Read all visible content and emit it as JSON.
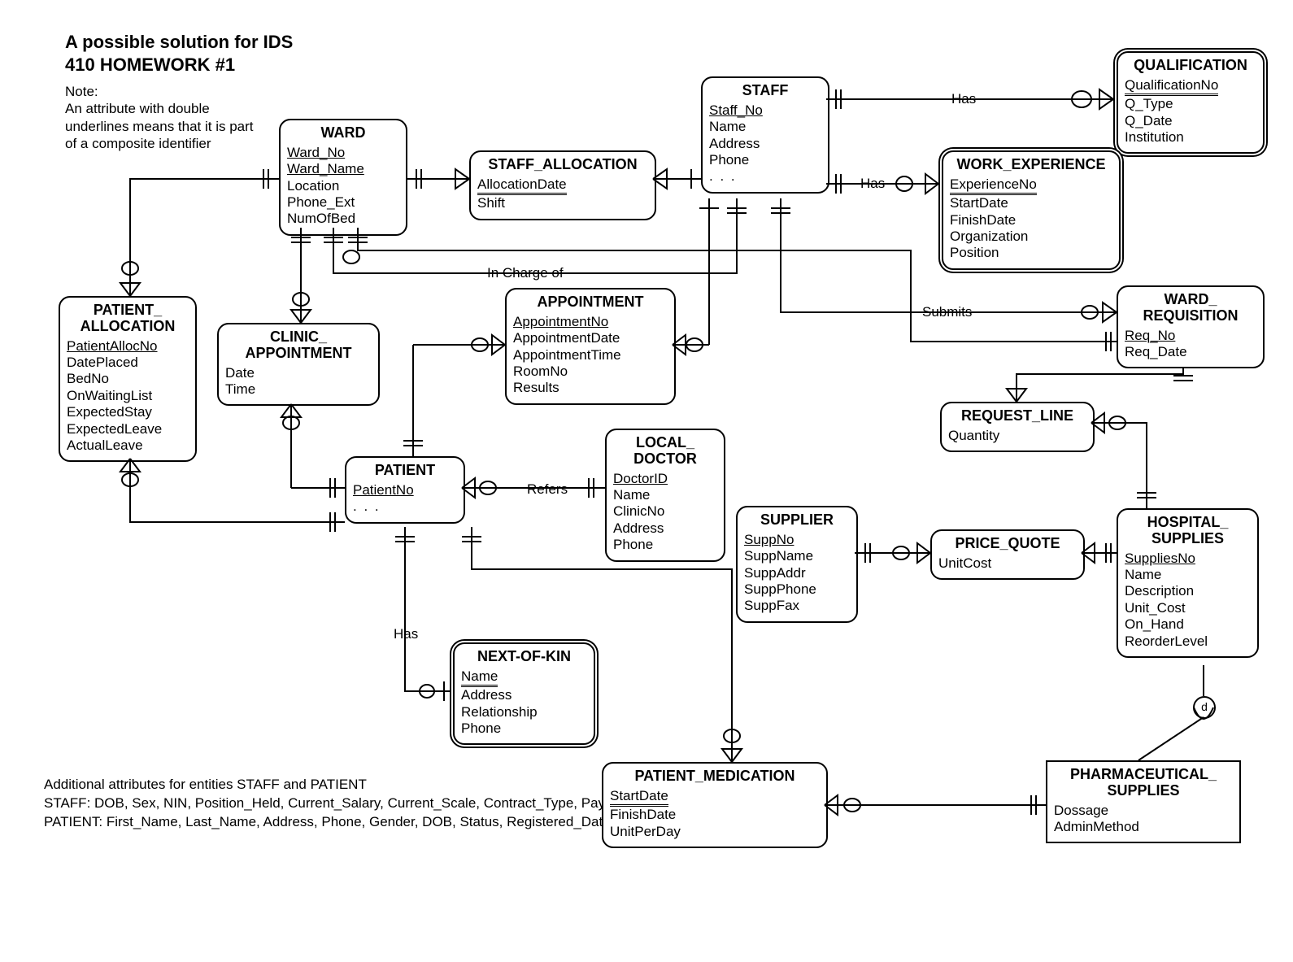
{
  "header": {
    "l1": "A possible solution for IDS",
    "l2": "410 HOMEWORK #1"
  },
  "note": {
    "l1": "Note:",
    "l2": "An attribute with double",
    "l3": "underlines  means that it is part",
    "l4": "of a composite identifier"
  },
  "footer": {
    "l1": "Additional attributes for entities STAFF and PATIENT",
    "l2": "STAFF: DOB, Sex, NIN, Position_Held, Current_Salary, Current_Scale, Contract_Type, Payment_Type, Hours",
    "l3": "PATIENT: First_Name, Last_Name, Address, Phone, Gender, DOB, Status, Registered_Date"
  },
  "entities": {
    "ward": {
      "name": "WARD",
      "a": [
        "Ward_No",
        "Ward_Name",
        "Location",
        "Phone_Ext",
        "NumOfBed"
      ]
    },
    "staff": {
      "name": "STAFF",
      "a": [
        "Staff_No",
        "Name",
        "Address",
        "Phone",
        ". . ."
      ]
    },
    "qualification": {
      "name": "QUALIFICATION",
      "a": [
        "QualificationNo",
        "Q_Type",
        "Q_Date",
        "Institution"
      ]
    },
    "workexp": {
      "name": "WORK_EXPERIENCE",
      "a": [
        "ExperienceNo",
        "StartDate",
        "FinishDate",
        "Organization",
        "Position"
      ]
    },
    "staffalloc": {
      "name": "STAFF_ALLOCATION",
      "a": [
        "AllocationDate",
        "Shift"
      ]
    },
    "patientalloc": {
      "name1": "PATIENT_",
      "name2": "ALLOCATION",
      "a": [
        "PatientAllocNo",
        "DatePlaced",
        "BedNo",
        "OnWaitingList",
        "ExpectedStay",
        "ExpectedLeave",
        "ActualLeave"
      ]
    },
    "clinicappt": {
      "name1": "CLINIC_",
      "name2": "APPOINTMENT",
      "a": [
        "Date",
        "Time"
      ]
    },
    "appointment": {
      "name": "APPOINTMENT",
      "a": [
        "AppointmentNo",
        "AppointmentDate",
        "AppointmentTime",
        "RoomNo",
        "Results"
      ]
    },
    "wardreq": {
      "name1": "WARD_",
      "name2": "REQUISITION",
      "a": [
        "Req_No",
        "Req_Date"
      ]
    },
    "requestline": {
      "name": "REQUEST_LINE",
      "a": [
        "Quantity"
      ]
    },
    "patient": {
      "name": "PATIENT",
      "a": [
        "PatientNo",
        ". . ."
      ]
    },
    "localdoc": {
      "name1": "LOCAL_",
      "name2": "DOCTOR",
      "a": [
        "DoctorID",
        "Name",
        "ClinicNo",
        "Address",
        "Phone"
      ]
    },
    "supplier": {
      "name": "SUPPLIER",
      "a": [
        "SuppNo",
        "SuppName",
        "SuppAddr",
        "SuppPhone",
        "SuppFax"
      ]
    },
    "pricequote": {
      "name": "PRICE_QUOTE",
      "a": [
        "UnitCost"
      ]
    },
    "hospsupp": {
      "name1": "HOSPITAL_",
      "name2": "SUPPLIES",
      "a": [
        "SuppliesNo",
        "Name",
        "Description",
        "Unit_Cost",
        "On_Hand",
        "ReorderLevel"
      ]
    },
    "nok": {
      "name": "NEXT-OF-KIN",
      "a": [
        "Name",
        "Address",
        "Relationship",
        "Phone"
      ]
    },
    "patmed": {
      "name": "PATIENT_MEDICATION",
      "a": [
        "StartDate",
        "FinishDate",
        "UnitPerDay"
      ]
    },
    "pharmsupp": {
      "name1": "PHARMACEUTICAL_",
      "name2": "SUPPLIES",
      "a": [
        "Dossage",
        "AdminMethod"
      ]
    }
  },
  "rels": {
    "has1": "Has",
    "has2": "Has",
    "has3": "Has",
    "incharge": "In Charge of",
    "submits": "Submits",
    "refers": "Refers"
  },
  "d": "d"
}
